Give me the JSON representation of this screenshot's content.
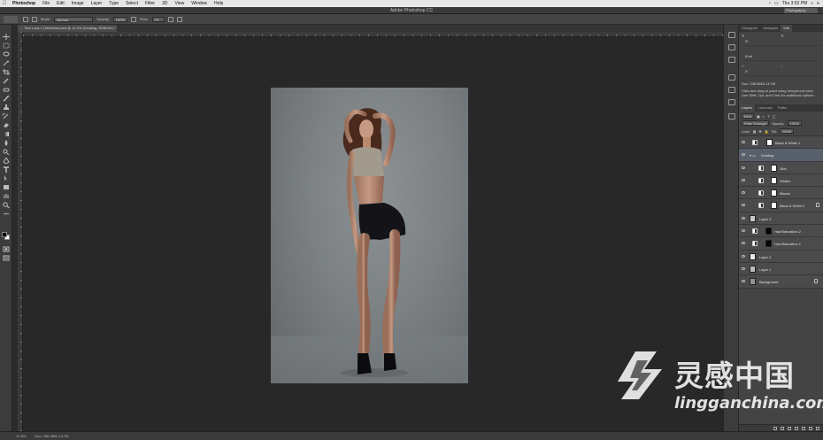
{
  "menubar": {
    "app": "Photoshop",
    "items": [
      "File",
      "Edit",
      "Image",
      "Layer",
      "Type",
      "Select",
      "Filter",
      "3D",
      "View",
      "Window",
      "Help"
    ],
    "clock": "Thu 3:52 PM"
  },
  "window": {
    "title": "Adobe Photoshop CC",
    "workspace": "Photography"
  },
  "options": {
    "mode_label": "Mode:",
    "mode_value": "Normal",
    "opacity_label": "Opacity:",
    "opacity_value": "100%",
    "flow_label": "Flow:",
    "flow_value": "70"
  },
  "document": {
    "tab": "Test Look 1 (Stretched.psd @ 12.5% (Grading, RGB/16*) *"
  },
  "status": {
    "zoom": "12.5%",
    "doc": "Doc: 236.9M/2.14.7M"
  },
  "info_panel": {
    "tabs": [
      "Histogram",
      "Navigator",
      "Info"
    ],
    "fields": [
      "R:",
      "",
      "8-bit",
      "",
      "X:",
      "",
      "",
      ""
    ],
    "doc": "Doc: 236.9M/3.14.7M",
    "hint": "Click and drag to paint using foreground color. Use Shift, Opt, and Cmd for additional options."
  },
  "layers_panel": {
    "tabs": [
      "Layers",
      "Channels",
      "Paths"
    ],
    "kind": "Kind",
    "blend_mode": "Pass Through",
    "opacity_label": "Opacity:",
    "opacity": "100%",
    "lock_label": "Lock:",
    "fill_label": "Fill:",
    "fill": "100%",
    "layers": [
      {
        "name": "Black & White 1",
        "type": "adj"
      },
      {
        "name": "Grading",
        "type": "group"
      },
      {
        "name": "Skin",
        "type": "adj"
      },
      {
        "name": "Whites",
        "type": "adj"
      },
      {
        "name": "Blacks",
        "type": "adj"
      },
      {
        "name": "Black & White 2",
        "type": "adj"
      },
      {
        "name": "Layer 3",
        "type": "pixel"
      },
      {
        "name": "Hue/Saturation 2",
        "type": "adjmask"
      },
      {
        "name": "Hue/Saturation 1",
        "type": "adjmask"
      },
      {
        "name": "Layer 2",
        "type": "pixel"
      },
      {
        "name": "Layer 1",
        "type": "pixel"
      },
      {
        "name": "Background",
        "type": "bg"
      }
    ]
  },
  "watermark": {
    "cn": "灵感中国",
    "en": "lingganchina.com"
  },
  "colors": {
    "canvas_bg": "#282828",
    "panel_bg": "#444444",
    "selected_group": "#58606c"
  }
}
